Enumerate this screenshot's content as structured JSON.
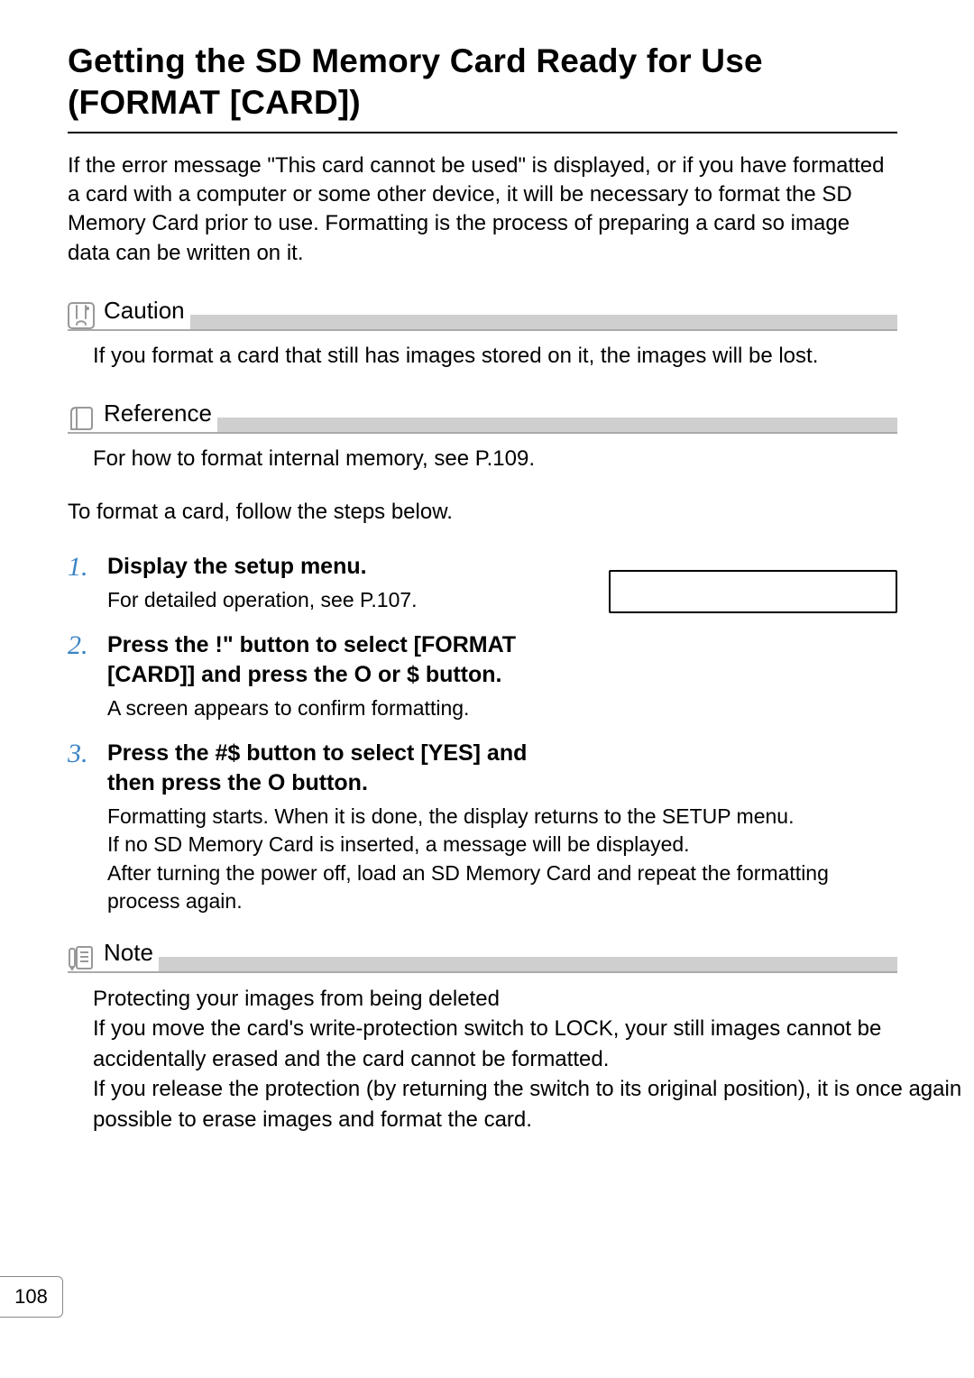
{
  "title": "Getting the SD Memory Card Ready for Use (FORMAT [CARD])",
  "intro": "If the error message \"This card cannot be used\" is displayed, or if you have formatted a card with a computer or some other device, it will be necessary to format the SD Memory Card prior to use. Formatting is the process of preparing a card so image data can be written on it.",
  "caution": {
    "label": "Caution",
    "body": "If you format a card that still has images stored on it, the images will be lost."
  },
  "reference": {
    "label": "Reference",
    "body": "For how to format internal memory, see P.109."
  },
  "lead": "To format a card, follow the steps below.",
  "steps": [
    {
      "num": "1.",
      "head": "Display the setup menu.",
      "text": "For detailed operation, see P.107."
    },
    {
      "num": "2.",
      "head": "Press the !\"  button to select [FORMAT [CARD]] and press the O   or $  button.",
      "text": "A screen appears to confirm formatting."
    },
    {
      "num": "3.",
      "head": "Press the #$  button to select [YES] and then press the O button.",
      "text": "Formatting starts. When it is done, the display returns to the SETUP menu.\nIf no SD Memory Card is inserted, a message will be displayed.\nAfter turning the power off, load an SD Memory Card and repeat the formatting process again."
    }
  ],
  "note": {
    "label": "Note",
    "body_lines": [
      "Protecting your images from being deleted",
      "If you move the card's write-protection switch to LOCK, your still images cannot be accidentally erased and the card cannot be formatted.",
      "If you release the protection (by returning the switch to its original position), it is once again possible to erase images and format the card."
    ]
  },
  "page_number": "108"
}
